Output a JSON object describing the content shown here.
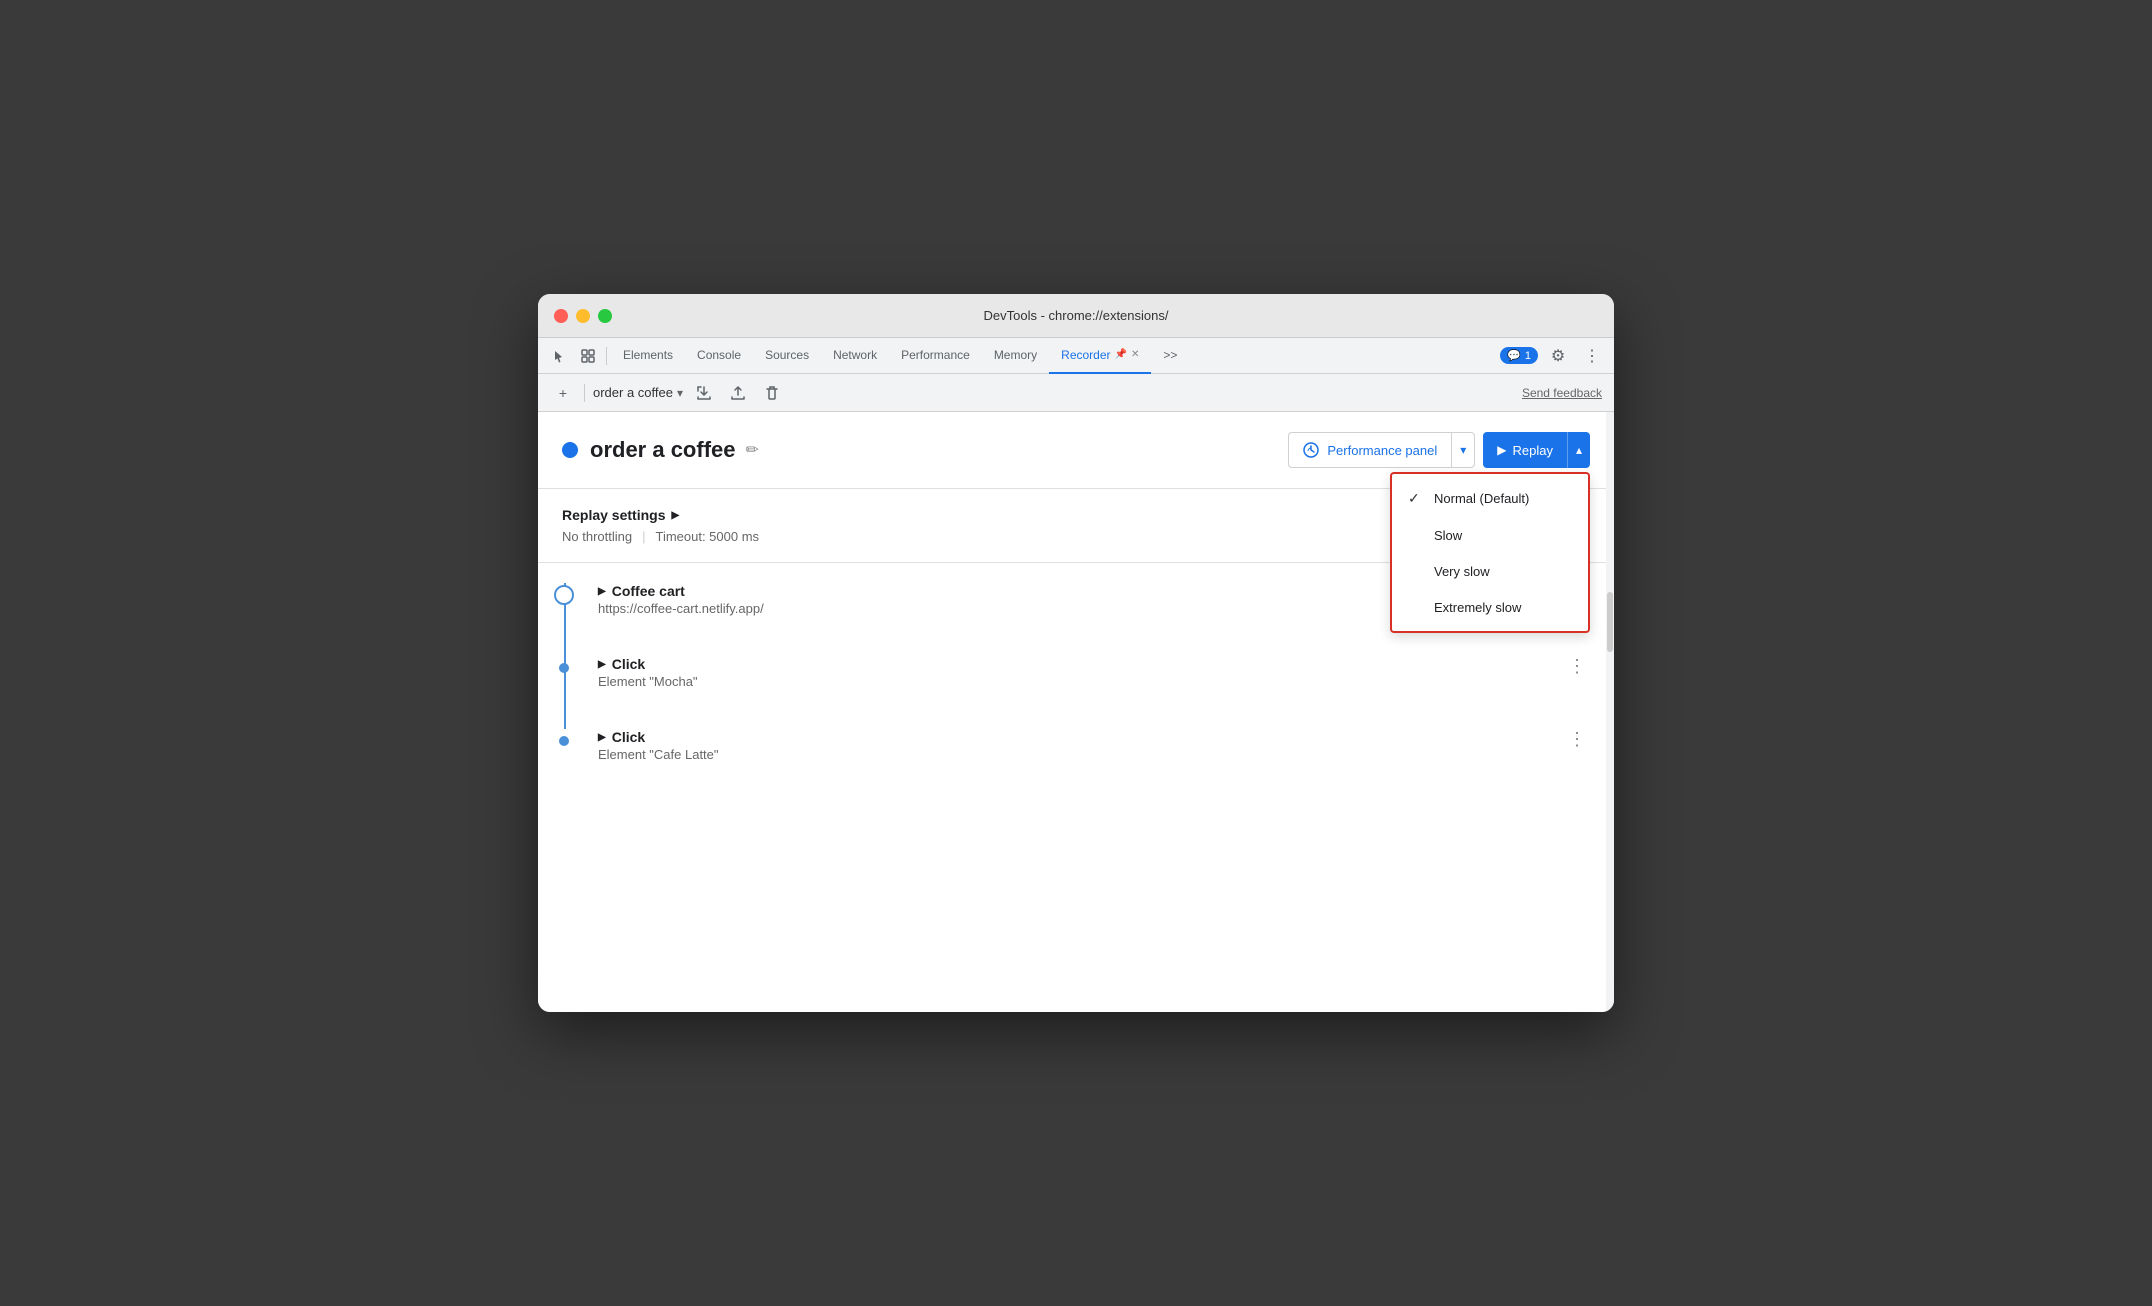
{
  "window": {
    "title": "DevTools - chrome://extensions/"
  },
  "tabs": {
    "items": [
      {
        "id": "elements",
        "label": "Elements",
        "active": false
      },
      {
        "id": "console",
        "label": "Console",
        "active": false
      },
      {
        "id": "sources",
        "label": "Sources",
        "active": false
      },
      {
        "id": "network",
        "label": "Network",
        "active": false
      },
      {
        "id": "performance",
        "label": "Performance",
        "active": false
      },
      {
        "id": "memory",
        "label": "Memory",
        "active": false
      },
      {
        "id": "recorder",
        "label": "Recorder",
        "active": true
      }
    ],
    "more_label": ">>",
    "chat_count": "1"
  },
  "secondary_toolbar": {
    "add_label": "+",
    "recording_name": "order a coffee",
    "send_feedback": "Send feedback"
  },
  "recording": {
    "title": "order a coffee",
    "performance_panel_label": "Performance panel",
    "replay_label": "Replay"
  },
  "settings": {
    "title": "Replay settings",
    "throttling": "No throttling",
    "timeout": "Timeout: 5000 ms"
  },
  "speed_dropdown": {
    "items": [
      {
        "id": "normal",
        "label": "Normal (Default)",
        "checked": true
      },
      {
        "id": "slow",
        "label": "Slow",
        "checked": false
      },
      {
        "id": "very-slow",
        "label": "Very slow",
        "checked": false
      },
      {
        "id": "extremely-slow",
        "label": "Extremely slow",
        "checked": false
      }
    ]
  },
  "steps": [
    {
      "id": "coffee-cart",
      "title": "Coffee cart",
      "subtitle": "https://coffee-cart.netlify.app/",
      "dot_type": "large",
      "expand": true
    },
    {
      "id": "click-mocha",
      "title": "Click",
      "subtitle": "Element \"Mocha\"",
      "dot_type": "small",
      "expand": false
    },
    {
      "id": "click-cafe-latte",
      "title": "Click",
      "subtitle": "Element \"Cafe Latte\"",
      "dot_type": "small",
      "expand": false
    }
  ],
  "colors": {
    "accent_blue": "#1a73e8",
    "dot_blue": "#4a90d9",
    "highlight_red": "#d93025"
  }
}
